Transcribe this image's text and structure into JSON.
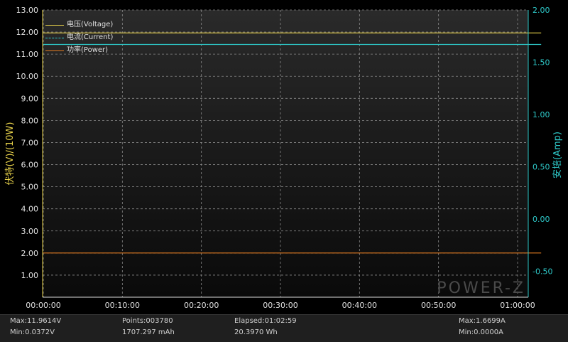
{
  "chart_data": {
    "type": "line",
    "left_axis": {
      "label": "伏特(V)/(10W)",
      "color": "#e8d24a",
      "range": [
        0,
        13.0
      ],
      "ticks": [
        "1.00",
        "2.00",
        "3.00",
        "4.00",
        "5.00",
        "6.00",
        "7.00",
        "8.00",
        "9.00",
        "10.00",
        "11.00",
        "12.00",
        "13.00"
      ]
    },
    "right_axis": {
      "label": "安培(Amp)",
      "color": "#2ec9c9",
      "range": [
        -0.75,
        2.0
      ],
      "ticks": [
        "-0.50",
        "0.00",
        "0.50",
        "1.00",
        "1.50",
        "2.00"
      ]
    },
    "x_axis": {
      "ticks": [
        "00:00:00",
        "00:10:00",
        "00:20:00",
        "00:30:00",
        "00:40:00",
        "00:50:00",
        "01:00:00"
      ],
      "range": [
        "00:00:00",
        "01:02:59"
      ]
    },
    "series": [
      {
        "name": "电压(Voltage)",
        "axis": "left",
        "color": "#e8d24a",
        "style": "solid",
        "x": [
          "00:00:00",
          "01:02:59"
        ],
        "values": [
          11.96,
          11.96
        ]
      },
      {
        "name": "电流(Current)",
        "axis": "right",
        "color": "#2ec9c9",
        "style": "solid",
        "x": [
          "00:00:00",
          "01:02:59"
        ],
        "values": [
          1.67,
          1.67
        ]
      },
      {
        "name": "功率(Power)",
        "axis": "left",
        "color": "#e07a20",
        "style": "solid",
        "x": [
          "00:00:00",
          "01:02:59"
        ],
        "values": [
          2.0,
          2.0
        ]
      }
    ],
    "grid": true,
    "legend_position": "top-left"
  },
  "watermark": "POWER-Z",
  "status": {
    "max_voltage": "Max:11.9614V",
    "min_voltage": "Min:0.0372V",
    "points": "Points:003780",
    "capacity": "1707.297 mAh",
    "elapsed": "Elapsed:01:02:59",
    "energy": "20.3970 Wh",
    "max_current": "Max:1.6699A",
    "min_current": "Min:0.0000A"
  },
  "colors": {
    "plot_bg_top": "#2a2a2a",
    "plot_bg_bottom": "#0a0a0a",
    "grid": "#8a8a8a",
    "axis_text": "#e0e0e0"
  }
}
